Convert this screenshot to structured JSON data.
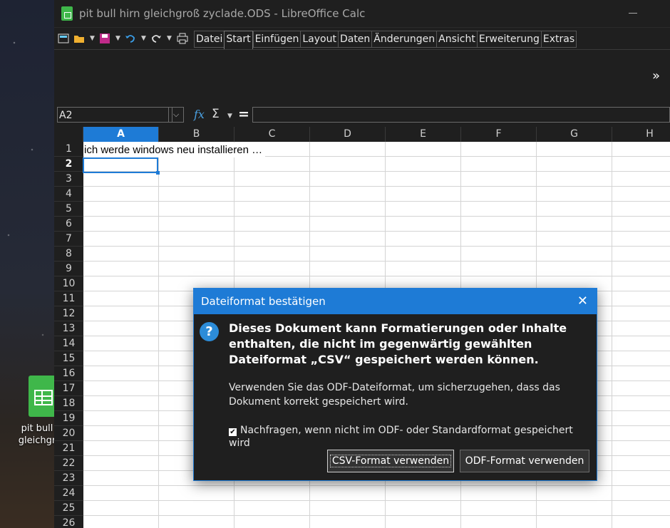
{
  "desktop": {
    "icon_label_line1": "pit bull",
    "icon_label_line2": "gleichgr"
  },
  "window": {
    "title": "pit bull hirn gleichgroß zyclade.ODS - LibreOffice Calc"
  },
  "toolbar": {
    "icons": [
      "new-document-icon",
      "open-folder-icon",
      "save-icon",
      "undo-icon",
      "redo-icon",
      "print-icon"
    ]
  },
  "menus": [
    "Datei",
    "Start",
    "Einfügen",
    "Layout",
    "Daten",
    "Änderungen",
    "Ansicht",
    "Erweiterung",
    "Extras"
  ],
  "ribbon": {
    "more_label": "»"
  },
  "formula_bar": {
    "name_box": "A2",
    "fx": "fx",
    "sigma": "Σ",
    "equals": "=",
    "formula": ""
  },
  "sheet": {
    "columns": [
      "A",
      "B",
      "C",
      "D",
      "E",
      "F",
      "G",
      "H"
    ],
    "selected_column": "A",
    "rows": [
      "1",
      "2",
      "3",
      "4",
      "5",
      "6",
      "7",
      "8",
      "9",
      "10",
      "11",
      "12",
      "13",
      "14",
      "15",
      "16",
      "17",
      "18",
      "19",
      "20",
      "21",
      "22",
      "23",
      "24",
      "25",
      "26"
    ],
    "selected_row": "2",
    "cell_A1": "ich werde windows neu installieren …"
  },
  "dialog": {
    "title": "Dateiformat bestätigen",
    "close": "✕",
    "icon": "question-icon",
    "main_text": "Dieses Dokument kann Formatierungen oder Inhalte enthalten, die nicht im gegenwärtig gewählten Dateiformat „CSV“ gespeichert werden können.",
    "sub_text": "Verwenden Sie das ODF-Dateiformat, um sicherzugehen, dass das Dokument korrekt gespeichert wird.",
    "checkbox_label": "Nachfragen, wenn nicht im ODF- oder Standardformat gespeichert wird",
    "checkbox_checked": true,
    "button_csv": "CSV-Format verwenden",
    "button_odf": "ODF-Format verwenden"
  },
  "colors": {
    "accent": "#1e7bd6",
    "dark_bg": "#1f1f1f",
    "spreadsheet_green": "#3fb74a"
  }
}
